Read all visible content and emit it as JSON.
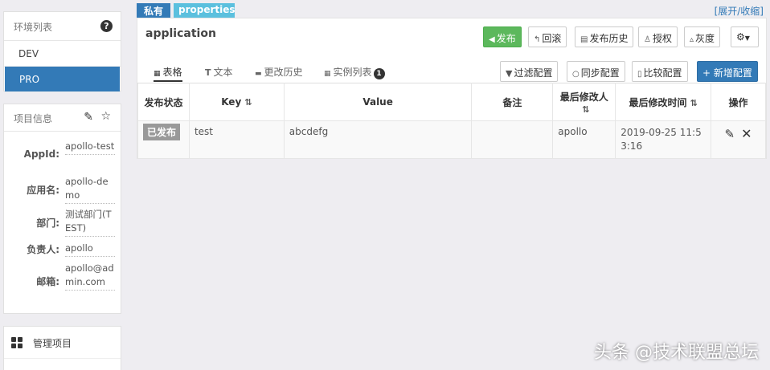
{
  "sidebar": {
    "env_list": {
      "title": "环境列表",
      "help_icon": "?",
      "items": [
        {
          "label": "DEV"
        },
        {
          "label": "PRO",
          "active": true
        }
      ]
    },
    "project_info": {
      "title": "项目信息",
      "rows": [
        {
          "label": "AppId:",
          "value": "apollo-test"
        },
        {
          "label": "应用名:",
          "value": "apollo-demo"
        },
        {
          "label": "部门:",
          "value": "测试部门(TEST)"
        },
        {
          "label": "负责人:",
          "value": "apollo"
        },
        {
          "label": "邮箱:",
          "value": "apollo@admin.com"
        }
      ]
    },
    "manage": {
      "items": [
        {
          "label": "管理项目"
        }
      ]
    }
  },
  "namespace": {
    "tag_private": "私有",
    "tag_format": "properties",
    "toggle": "[展开/收缩]",
    "title": "application",
    "buttons": {
      "publish": "发布",
      "rollback": "回滚",
      "history": "发布历史",
      "grant": "授权",
      "gray": "灰度",
      "filter": "过滤配置",
      "sync": "同步配置",
      "compare": "比较配置",
      "add": "+ 新增配置"
    },
    "tabs": [
      {
        "label": "表格",
        "active": true
      },
      {
        "label": "文本"
      },
      {
        "label": "更改历史"
      },
      {
        "label": "实例列表",
        "badge": "1"
      }
    ],
    "table": {
      "headers": [
        "发布状态",
        "Key",
        "Value",
        "备注",
        "最后修改人",
        "最后修改时间",
        "操作"
      ],
      "rows": [
        {
          "status": "已发布",
          "key": "test",
          "value": "abcdefg",
          "comment": "",
          "modifier": "apollo",
          "time": "2019-09-25 11:53:16"
        }
      ]
    }
  },
  "watermark": "头条 @技术联盟总坛",
  "colors": {
    "primary": "#337ab7",
    "success": "#5cb85c",
    "info": "#5bc0de"
  }
}
